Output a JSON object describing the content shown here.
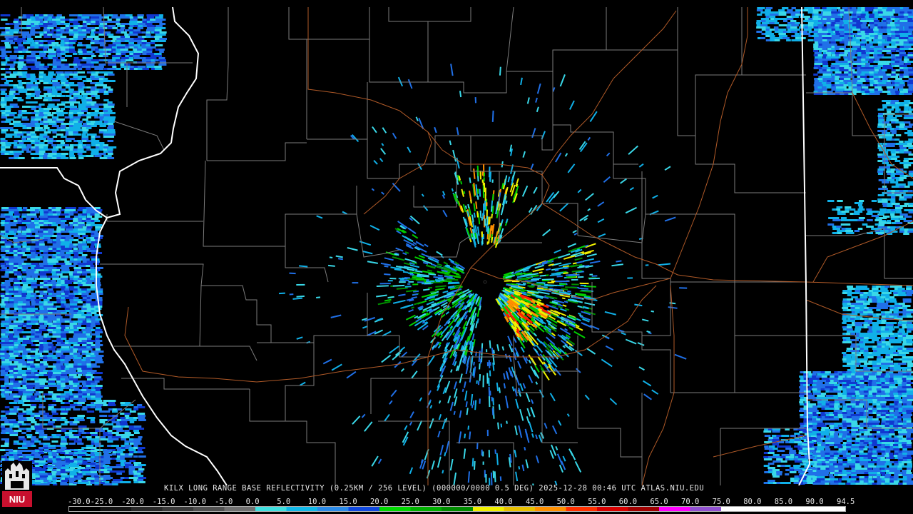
{
  "caption": "KILX LONG RANGE BASE REFLECTIVITY (0.25KM / 256 LEVEL) (000000/0000 0.5 DEG) 2025-12-28 00:46 UTC  ATLAS.NIU.EDU",
  "logo_text": "NIU",
  "scale": {
    "labels": [
      "-30.0",
      "-25.0",
      "-20.0",
      "-15.0",
      "-10.0",
      "-5.0",
      "0.0",
      "5.0",
      "10.0",
      "15.0",
      "20.0",
      "25.0",
      "30.0",
      "35.0",
      "40.0",
      "45.0",
      "50.0",
      "55.0",
      "60.0",
      "65.0",
      "70.0",
      "75.0",
      "80.0",
      "85.0",
      "90.0",
      "94.5"
    ],
    "colors": [
      "#000000",
      "#141414",
      "#282828",
      "#3a3a3a",
      "#505050",
      "#707070",
      "#3fe0e0",
      "#10b8e8",
      "#2a8ae8",
      "#1048e0",
      "#00d800",
      "#00b000",
      "#008c00",
      "#f0f000",
      "#e8c000",
      "#ff9000",
      "#ff3000",
      "#d80000",
      "#a00000",
      "#ff00ff",
      "#9050d0",
      "#ffffff",
      "#ffffff",
      "#ffffff",
      "#ffffff"
    ]
  },
  "radar_colors": {
    "light_cyan": "#39d8e8",
    "cyan": "#10b0e8",
    "blue": "#2070e8",
    "dark_blue": "#1038d0",
    "green": "#00d000",
    "dark_green": "#009000",
    "yellow": "#f0f000",
    "orange": "#ff9000",
    "red": "#ff2000"
  },
  "map_colors": {
    "county_border": "#808080",
    "state_border": "#ffffff",
    "highway": "#b05a28"
  }
}
